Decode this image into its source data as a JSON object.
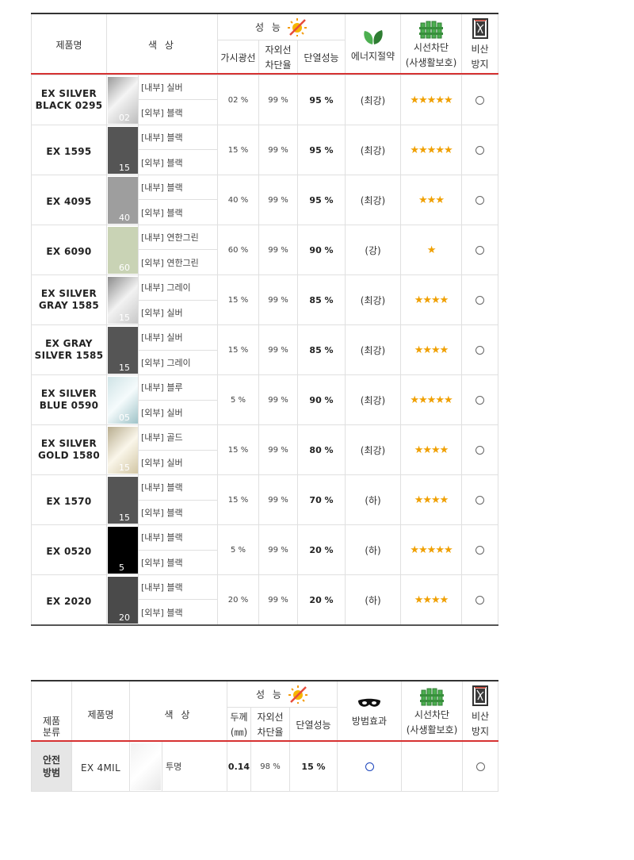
{
  "table1": {
    "header": {
      "product": "제품명",
      "color": "색 상",
      "performance": "성 능",
      "visible": "가시광선",
      "uv": "자외선\n차단율",
      "heat": "단열성능",
      "energy": "에너지절약",
      "privacy": "시선차단\n(사생활보호)",
      "shatter": "비산\n방지"
    },
    "rows": [
      {
        "name": "EX SILVER\nBLACK 0295",
        "swatch_num": "02",
        "inner": "[내부] 실버",
        "outer": "[외부] 블랙",
        "visible": "02 %",
        "uv": "99 %",
        "heat": "95 %",
        "energy": "(최강)",
        "stars": "★★★★★"
      },
      {
        "name": "EX 1595",
        "swatch_num": "15",
        "inner": "[내부] 블랙",
        "outer": "[외부] 블랙",
        "visible": "15 %",
        "uv": "99 %",
        "heat": "95 %",
        "energy": "(최강)",
        "stars": "★★★★★"
      },
      {
        "name": "EX 4095",
        "swatch_num": "40",
        "inner": "[내부] 블랙",
        "outer": "[외부] 블랙",
        "visible": "40 %",
        "uv": "99 %",
        "heat": "95 %",
        "energy": "(최강)",
        "stars": "★★★"
      },
      {
        "name": "EX 6090",
        "swatch_num": "60",
        "inner": "[내부] 연한그린",
        "outer": "[외부] 연한그린",
        "visible": "60 %",
        "uv": "99 %",
        "heat": "90 %",
        "energy": "(강)",
        "stars": "★"
      },
      {
        "name": "EX SILVER\nGRAY 1585",
        "swatch_num": "15",
        "inner": "[내부] 그레이",
        "outer": "[외부] 실버",
        "visible": "15 %",
        "uv": "99 %",
        "heat": "85 %",
        "energy": "(최강)",
        "stars": "★★★★"
      },
      {
        "name": "EX GRAY\nSILVER 1585",
        "swatch_num": "15",
        "inner": "[내부] 실버",
        "outer": "[외부] 그레이",
        "visible": "15 %",
        "uv": "99 %",
        "heat": "85 %",
        "energy": "(최강)",
        "stars": "★★★★"
      },
      {
        "name": "EX SILVER\nBLUE 0590",
        "swatch_num": "05",
        "inner": "[내부] 블루",
        "outer": "[외부] 실버",
        "visible": "5 %",
        "uv": "99 %",
        "heat": "90 %",
        "energy": "(최강)",
        "stars": "★★★★★"
      },
      {
        "name": "EX SILVER\nGOLD 1580",
        "swatch_num": "15",
        "inner": "[내부] 골드",
        "outer": "[외부] 실버",
        "visible": "15 %",
        "uv": "99 %",
        "heat": "80 %",
        "energy": "(최강)",
        "stars": "★★★★"
      },
      {
        "name": "EX 1570",
        "swatch_num": "15",
        "inner": "[내부] 블랙",
        "outer": "[외부] 블랙",
        "visible": "15 %",
        "uv": "99 %",
        "heat": "70 %",
        "energy": "(하)",
        "stars": "★★★★"
      },
      {
        "name": "EX 0520",
        "swatch_num": "5",
        "inner": "[내부] 블랙",
        "outer": "[외부] 블랙",
        "visible": "5 %",
        "uv": "99 %",
        "heat": "20 %",
        "energy": "(하)",
        "stars": "★★★★★"
      },
      {
        "name": "EX 2020",
        "swatch_num": "20",
        "inner": "[내부] 블랙",
        "outer": "[외부] 블랙",
        "visible": "20 %",
        "uv": "99 %",
        "heat": "20 %",
        "energy": "(하)",
        "stars": "★★★★"
      }
    ]
  },
  "table2": {
    "header": {
      "category": "제품\n분류",
      "product": "제품명",
      "color": "색 상",
      "performance": "성 능",
      "thickness": "두께\n(㎜)",
      "uv": "자외선\n차단율",
      "heat": "단열성능",
      "crime": "방범효과",
      "privacy": "시선차단\n(사생활보호)",
      "shatter": "비산\n방지"
    },
    "row": {
      "category": "안전\n방범",
      "name": "EX 4MIL",
      "color": "투명",
      "thickness": "0.14",
      "uv": "98 %",
      "heat": "15 %"
    }
  },
  "colors": {
    "red_rule": "#d63232",
    "star": "#f0a000",
    "category_bg": "#e6e6e6"
  },
  "icons": [
    "sun-icon",
    "leaf-icon",
    "fence-icon",
    "shatter-window-icon",
    "mask-icon"
  ]
}
